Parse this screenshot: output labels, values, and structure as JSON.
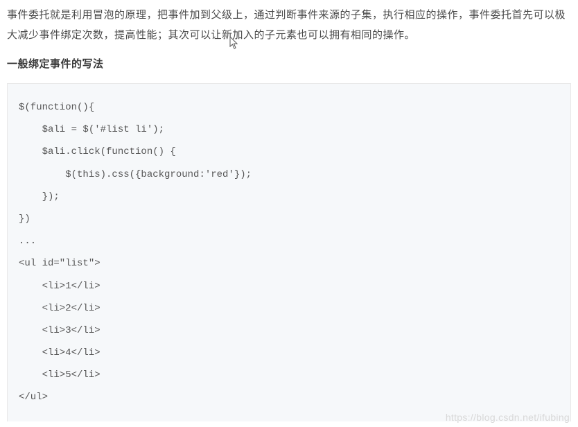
{
  "article": {
    "paragraph1": "事件委托就是利用冒泡的原理，把事件加到父级上，通过判断事件来源的子集，执行相应的操作，事件委托首先可以极大减少事件绑定次数，提高性能；其次可以让新加入的子元素也可以拥有相同的操作。",
    "heading": "一般绑定事件的写法",
    "code": "$(function(){\n    $ali = $('#list li');\n    $ali.click(function() {\n        $(this).css({background:'red'});\n    });\n})\n...\n<ul id=\"list\">\n    <li>1</li>\n    <li>2</li>\n    <li>3</li>\n    <li>4</li>\n    <li>5</li>\n</ul>"
  },
  "watermark": "https://blog.csdn.net/ifubing"
}
